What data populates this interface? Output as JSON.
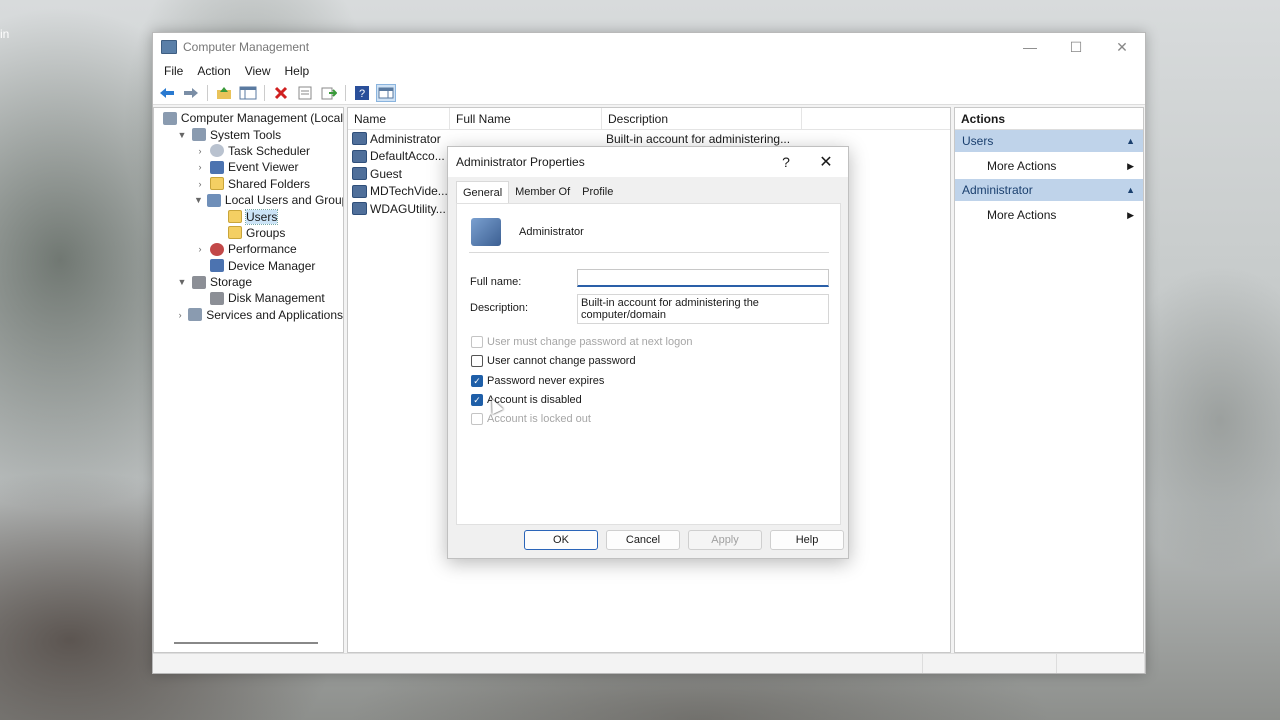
{
  "desktop": {
    "partial_text": "in"
  },
  "window": {
    "title": "Computer Management",
    "controls": {
      "minimize": "—",
      "maximize": "☐",
      "close": "✕"
    },
    "menu": [
      "File",
      "Action",
      "View",
      "Help"
    ],
    "toolbar_icons": [
      "back-arrow-icon",
      "forward-arrow-icon",
      "up-folder-icon",
      "show-hide-tree-icon",
      "delete-icon",
      "properties-icon",
      "export-icon",
      "help-icon",
      "action-pane-icon"
    ]
  },
  "tree": {
    "items": [
      {
        "label": "Computer Management (Local",
        "indent": 0,
        "expander": "",
        "icon": "gear"
      },
      {
        "label": "System Tools",
        "indent": 1,
        "expander": "▼",
        "icon": "gear"
      },
      {
        "label": "Task Scheduler",
        "indent": 2,
        "expander": "›",
        "icon": "clock"
      },
      {
        "label": "Event Viewer",
        "indent": 2,
        "expander": "›",
        "icon": "blue"
      },
      {
        "label": "Shared Folders",
        "indent": 2,
        "expander": "›",
        "icon": "folder"
      },
      {
        "label": "Local Users and Groups",
        "indent": 2,
        "expander": "▼",
        "icon": "users"
      },
      {
        "label": "Users",
        "indent": 3,
        "expander": "",
        "icon": "folder",
        "selected": true
      },
      {
        "label": "Groups",
        "indent": 3,
        "expander": "",
        "icon": "folder"
      },
      {
        "label": "Performance",
        "indent": 2,
        "expander": "›",
        "icon": "red"
      },
      {
        "label": "Device Manager",
        "indent": 2,
        "expander": "",
        "icon": "blue"
      },
      {
        "label": "Storage",
        "indent": 1,
        "expander": "▼",
        "icon": "drive"
      },
      {
        "label": "Disk Management",
        "indent": 2,
        "expander": "",
        "icon": "drive"
      },
      {
        "label": "Services and Applications",
        "indent": 1,
        "expander": "›",
        "icon": "gear"
      }
    ]
  },
  "list": {
    "columns": [
      "Name",
      "Full Name",
      "Description"
    ],
    "rows": [
      {
        "name": "Administrator",
        "full_name": "",
        "description": "Built-in account for administering..."
      },
      {
        "name": "DefaultAcco...",
        "full_name": "",
        "description": ""
      },
      {
        "name": "Guest",
        "full_name": "",
        "description": ""
      },
      {
        "name": "MDTechVide...",
        "full_name": "",
        "description": ""
      },
      {
        "name": "WDAGUtility...",
        "full_name": "",
        "description": ""
      }
    ]
  },
  "actions": {
    "title": "Actions",
    "sections": [
      {
        "header": "Users",
        "item": "More Actions"
      },
      {
        "header": "Administrator",
        "item": "More Actions"
      }
    ]
  },
  "dialog": {
    "title": "Administrator Properties",
    "help_glyph": "?",
    "close_glyph": "✕",
    "tabs": [
      "General",
      "Member Of",
      "Profile"
    ],
    "active_tab": "General",
    "user_name": "Administrator",
    "full_name_label": "Full name:",
    "full_name_value": "",
    "description_label": "Description:",
    "description_value": "Built-in account for administering the computer/domain",
    "checkboxes": [
      {
        "label": "User must change password at next logon",
        "checked": false,
        "disabled": true
      },
      {
        "label": "User cannot change password",
        "checked": false,
        "disabled": false
      },
      {
        "label": "Password never expires",
        "checked": true,
        "disabled": false
      },
      {
        "label": "Account is disabled",
        "checked": true,
        "disabled": false
      },
      {
        "label": "Account is locked out",
        "checked": false,
        "disabled": true
      }
    ],
    "buttons": {
      "ok": "OK",
      "cancel": "Cancel",
      "apply": "Apply",
      "help": "Help"
    }
  },
  "colors": {
    "accent": "#1f5fa8",
    "action_header": "#bfd3ea",
    "selection": "#cce4f7"
  }
}
